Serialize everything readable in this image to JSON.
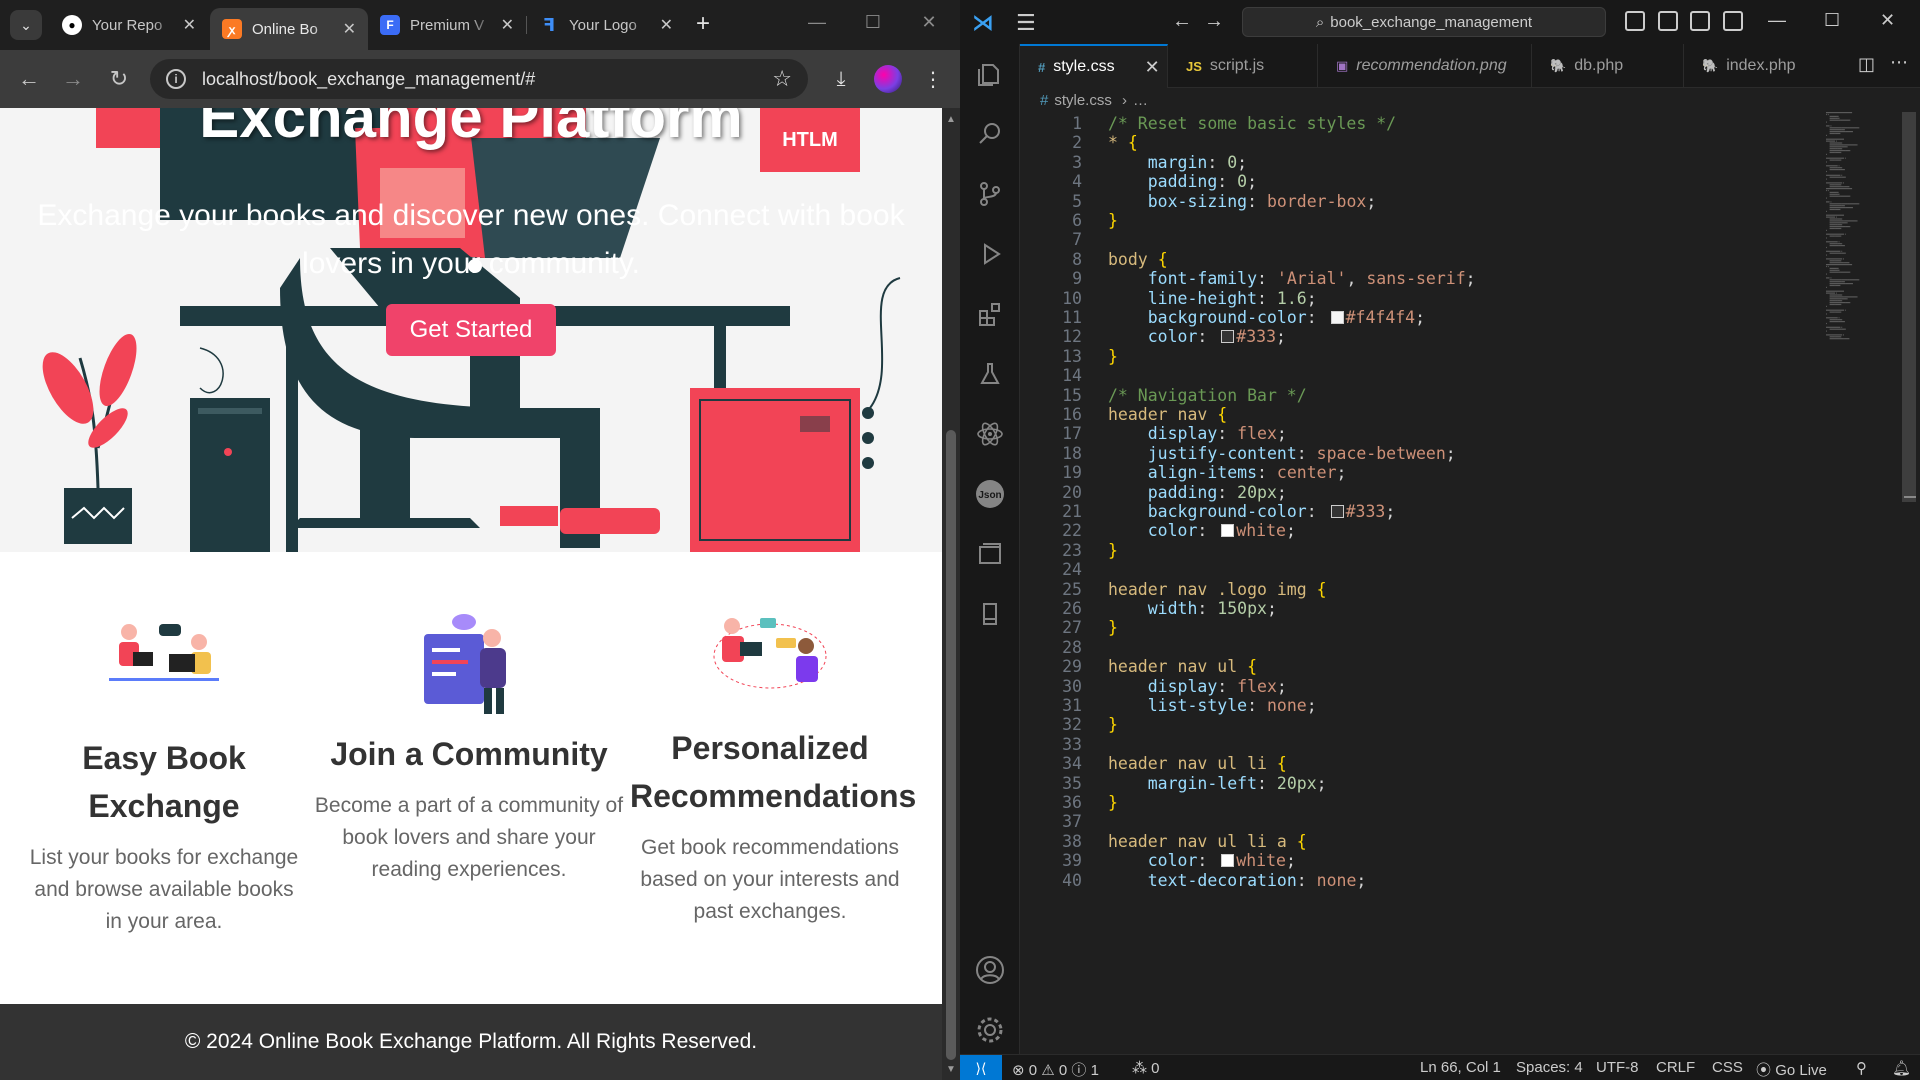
{
  "browser": {
    "tabs": [
      {
        "title": "Your Repo",
        "favicon": "github-icon"
      },
      {
        "title": "Online Bo",
        "favicon": "xampp-icon",
        "active": true
      },
      {
        "title": "Premium V",
        "favicon": "f-brand-icon"
      },
      {
        "title": "Your Logo",
        "favicon": "logo-maker-icon"
      }
    ],
    "url": "localhost/book_exchange_management/#"
  },
  "page": {
    "hero_title": "Exchange Platform",
    "hero_subtitle": "Exchange your books and discover new ones. Connect with book lovers in your community.",
    "get_started": "Get Started",
    "htlm_badge": "HTLM",
    "features": [
      {
        "title": "Easy Book Exchange",
        "description": "List your books for exchange and browse available books in your area.",
        "illustration": "people-with-laptops-illustration"
      },
      {
        "title": "Join a Community",
        "description": "Become a part of a community of book lovers and share your reading experiences.",
        "illustration": "community-chat-illustration"
      },
      {
        "title": "Personalized Recommendations",
        "description": "Get book recommendations based on your interests and past exchanges.",
        "illustration": "recommendation-chat-illustration"
      }
    ],
    "footer": "© 2024 Online Book Exchange Platform. All Rights Reserved."
  },
  "vscode": {
    "command_center": "book_exchange_management",
    "tabs": [
      {
        "label": "style.css",
        "type": "#",
        "active": true
      },
      {
        "label": "script.js",
        "type": "JS"
      },
      {
        "label": "recommendation.png",
        "type": "img"
      },
      {
        "label": "db.php",
        "type": "php"
      },
      {
        "label": "index.php",
        "type": "php"
      }
    ],
    "breadcrumb_file": "style.css",
    "breadcrumb_rest": "…",
    "code_lines": [
      [
        [
          "c-com",
          "/* Reset some basic styles */"
        ]
      ],
      [
        [
          "c-sel",
          "*"
        ],
        [
          "c-txt",
          " "
        ],
        [
          "c-brace",
          "{"
        ]
      ],
      [
        [
          "c-txt",
          "    "
        ],
        [
          "c-prop",
          "margin"
        ],
        [
          "c-txt",
          ": "
        ],
        [
          "c-num",
          "0"
        ],
        [
          "c-txt",
          ";"
        ]
      ],
      [
        [
          "c-txt",
          "    "
        ],
        [
          "c-prop",
          "padding"
        ],
        [
          "c-txt",
          ": "
        ],
        [
          "c-num",
          "0"
        ],
        [
          "c-txt",
          ";"
        ]
      ],
      [
        [
          "c-txt",
          "    "
        ],
        [
          "c-prop",
          "box-sizing"
        ],
        [
          "c-txt",
          ": "
        ],
        [
          "c-val",
          "border-box"
        ],
        [
          "c-txt",
          ";"
        ]
      ],
      [
        [
          "c-brace",
          "}"
        ]
      ],
      [],
      [
        [
          "c-sel",
          "body"
        ],
        [
          "c-txt",
          " "
        ],
        [
          "c-brace",
          "{"
        ]
      ],
      [
        [
          "c-txt",
          "    "
        ],
        [
          "c-prop",
          "font-family"
        ],
        [
          "c-txt",
          ": "
        ],
        [
          "c-val",
          "'Arial'"
        ],
        [
          "c-txt",
          ", "
        ],
        [
          "c-val",
          "sans-serif"
        ],
        [
          "c-txt",
          ";"
        ]
      ],
      [
        [
          "c-txt",
          "    "
        ],
        [
          "c-prop",
          "line-height"
        ],
        [
          "c-txt",
          ": "
        ],
        [
          "c-num",
          "1.6"
        ],
        [
          "c-txt",
          ";"
        ]
      ],
      [
        [
          "c-txt",
          "    "
        ],
        [
          "c-prop",
          "background-color"
        ],
        [
          "c-txt",
          ": "
        ],
        [
          "swatch",
          "#f4f4f4"
        ],
        [
          "c-val",
          "#f4f4f4"
        ],
        [
          "c-txt",
          ";"
        ]
      ],
      [
        [
          "c-txt",
          "    "
        ],
        [
          "c-prop",
          "color"
        ],
        [
          "c-txt",
          ": "
        ],
        [
          "swatch",
          "#333"
        ],
        [
          "c-val",
          "#333"
        ],
        [
          "c-txt",
          ";"
        ]
      ],
      [
        [
          "c-brace",
          "}"
        ]
      ],
      [],
      [
        [
          "c-com",
          "/* Navigation Bar */"
        ]
      ],
      [
        [
          "c-sel",
          "header nav"
        ],
        [
          "c-txt",
          " "
        ],
        [
          "c-brace",
          "{"
        ]
      ],
      [
        [
          "c-txt",
          "    "
        ],
        [
          "c-prop",
          "display"
        ],
        [
          "c-txt",
          ": "
        ],
        [
          "c-val",
          "flex"
        ],
        [
          "c-txt",
          ";"
        ]
      ],
      [
        [
          "c-txt",
          "    "
        ],
        [
          "c-prop",
          "justify-content"
        ],
        [
          "c-txt",
          ": "
        ],
        [
          "c-val",
          "space-between"
        ],
        [
          "c-txt",
          ";"
        ]
      ],
      [
        [
          "c-txt",
          "    "
        ],
        [
          "c-prop",
          "align-items"
        ],
        [
          "c-txt",
          ": "
        ],
        [
          "c-val",
          "center"
        ],
        [
          "c-txt",
          ";"
        ]
      ],
      [
        [
          "c-txt",
          "    "
        ],
        [
          "c-prop",
          "padding"
        ],
        [
          "c-txt",
          ": "
        ],
        [
          "c-num",
          "20px"
        ],
        [
          "c-txt",
          ";"
        ]
      ],
      [
        [
          "c-txt",
          "    "
        ],
        [
          "c-prop",
          "background-color"
        ],
        [
          "c-txt",
          ": "
        ],
        [
          "swatch",
          "#333"
        ],
        [
          "c-val",
          "#333"
        ],
        [
          "c-txt",
          ";"
        ]
      ],
      [
        [
          "c-txt",
          "    "
        ],
        [
          "c-prop",
          "color"
        ],
        [
          "c-txt",
          ": "
        ],
        [
          "swatch",
          "white"
        ],
        [
          "c-val",
          "white"
        ],
        [
          "c-txt",
          ";"
        ]
      ],
      [
        [
          "c-brace",
          "}"
        ]
      ],
      [],
      [
        [
          "c-sel",
          "header nav .logo img"
        ],
        [
          "c-txt",
          " "
        ],
        [
          "c-brace",
          "{"
        ]
      ],
      [
        [
          "c-txt",
          "    "
        ],
        [
          "c-prop",
          "width"
        ],
        [
          "c-txt",
          ": "
        ],
        [
          "c-num",
          "150px"
        ],
        [
          "c-txt",
          ";"
        ]
      ],
      [
        [
          "c-brace",
          "}"
        ]
      ],
      [],
      [
        [
          "c-sel",
          "header nav ul"
        ],
        [
          "c-txt",
          " "
        ],
        [
          "c-brace",
          "{"
        ]
      ],
      [
        [
          "c-txt",
          "    "
        ],
        [
          "c-prop",
          "display"
        ],
        [
          "c-txt",
          ": "
        ],
        [
          "c-val",
          "flex"
        ],
        [
          "c-txt",
          ";"
        ]
      ],
      [
        [
          "c-txt",
          "    "
        ],
        [
          "c-prop",
          "list-style"
        ],
        [
          "c-txt",
          ": "
        ],
        [
          "c-val",
          "none"
        ],
        [
          "c-txt",
          ";"
        ]
      ],
      [
        [
          "c-brace",
          "}"
        ]
      ],
      [],
      [
        [
          "c-sel",
          "header nav ul li"
        ],
        [
          "c-txt",
          " "
        ],
        [
          "c-brace",
          "{"
        ]
      ],
      [
        [
          "c-txt",
          "    "
        ],
        [
          "c-prop",
          "margin-left"
        ],
        [
          "c-txt",
          ": "
        ],
        [
          "c-num",
          "20px"
        ],
        [
          "c-txt",
          ";"
        ]
      ],
      [
        [
          "c-brace",
          "}"
        ]
      ],
      [],
      [
        [
          "c-sel",
          "header nav ul li a"
        ],
        [
          "c-txt",
          " "
        ],
        [
          "c-brace",
          "{"
        ]
      ],
      [
        [
          "c-txt",
          "    "
        ],
        [
          "c-prop",
          "color"
        ],
        [
          "c-txt",
          ": "
        ],
        [
          "swatch",
          "white"
        ],
        [
          "c-val",
          "white"
        ],
        [
          "c-txt",
          ";"
        ]
      ],
      [
        [
          "c-txt",
          "    "
        ],
        [
          "c-prop",
          "text-decoration"
        ],
        [
          "c-txt",
          ": "
        ],
        [
          "c-val",
          "none"
        ],
        [
          "c-txt",
          ";"
        ]
      ]
    ],
    "status": {
      "errors": "0",
      "warnings": "0",
      "info": "1",
      "ports": "0",
      "position": "Ln 66, Col 1",
      "spaces": "Spaces: 4",
      "encoding": "UTF-8",
      "eol": "CRLF",
      "language": "CSS",
      "golive": "Go Live"
    }
  },
  "colors": {
    "accent_pink": "#f0436a",
    "vscode_blue": "#0078d4"
  }
}
